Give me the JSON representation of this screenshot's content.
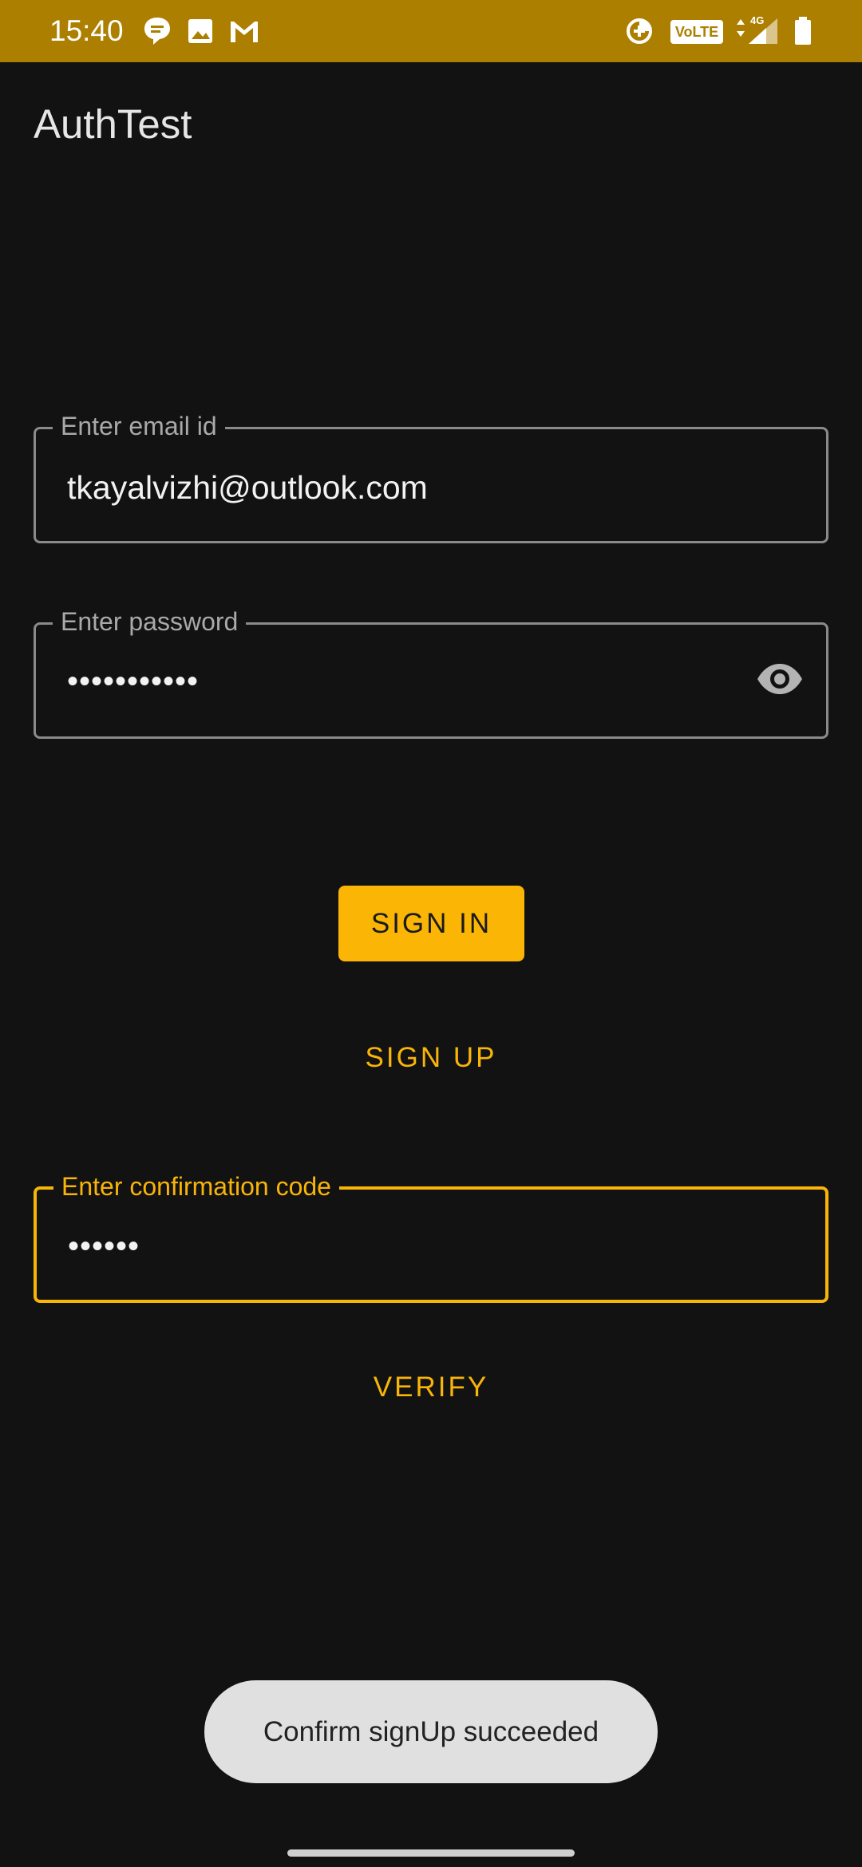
{
  "status_bar": {
    "time": "15:40",
    "icons": [
      "chat-bubble-icon",
      "image-icon",
      "gmail-icon",
      "data-saver-icon",
      "volte-icon",
      "signal-4g-icon",
      "battery-icon"
    ],
    "volte_label": "VoLTE",
    "network_label": "4G"
  },
  "app": {
    "title": "AuthTest"
  },
  "email_field": {
    "label": "Enter email id",
    "value": "tkayalvizhi@outlook.com"
  },
  "password_field": {
    "label": "Enter password",
    "value": "•••••••••••",
    "toggle_icon": "eye-icon"
  },
  "buttons": {
    "sign_in": "SIGN IN",
    "sign_up": "SIGN UP",
    "verify": "VERIFY"
  },
  "confirmation_field": {
    "label": "Enter confirmation code",
    "value": "••••••"
  },
  "toast": {
    "message": "Confirm signUp succeeded"
  },
  "colors": {
    "accent": "#f9b408",
    "status_bar": "#ad7f00",
    "background": "#121212",
    "toast_bg": "#e0e0e0"
  }
}
